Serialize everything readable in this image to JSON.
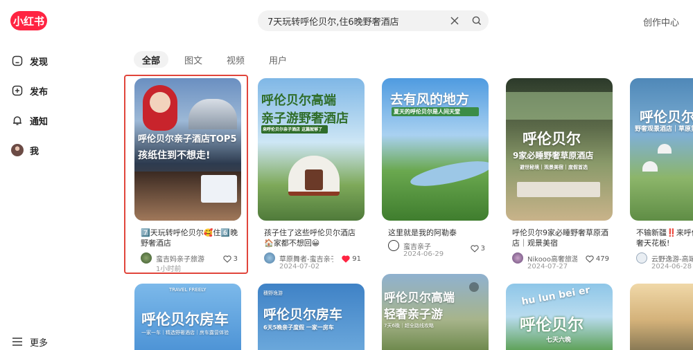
{
  "header": {
    "logo": "小红书",
    "search_value": "7天玩转呼伦贝尔,住6晚野奢酒店",
    "creator_center": "创作中心"
  },
  "sidebar": {
    "items": [
      {
        "label": "发现",
        "icon": "home-icon"
      },
      {
        "label": "发布",
        "icon": "add-square-icon"
      },
      {
        "label": "通知",
        "icon": "bell-icon"
      },
      {
        "label": "我",
        "icon": "avatar"
      }
    ],
    "more": "更多"
  },
  "tabs": [
    "全部",
    "图文",
    "视频",
    "用户"
  ],
  "active_tab": "全部",
  "cards": [
    {
      "title": "7️⃣天玩转呼伦贝尔🥰住6️⃣晚野奢酒店",
      "author": "蛮吉妈亲子旅游",
      "date": "1小时前",
      "likes": "3",
      "liked": false,
      "overlay": [
        "呼伦贝尔亲子酒店TOP5",
        "孩纸住到不想走!"
      ]
    },
    {
      "title": "孩子住了这些呼伦贝尔酒店🏠家都不想回😀",
      "author": "草原舞者-蛮吉亲子旅游",
      "date": "2024-07-02",
      "likes": "91",
      "liked": true,
      "overlay": [
        "呼伦贝尔高端",
        "亲子游野奢酒店",
        "来呼伦贝尔亲子酒店 这篇就够了"
      ]
    },
    {
      "title": "这里就是我的阿勒泰",
      "author": "蛮吉亲子",
      "date": "2024-06-29",
      "likes": "3",
      "liked": false,
      "overlay": [
        "去有风的地方",
        "夏天的呼伦贝尔是人间天堂"
      ]
    },
    {
      "title": "呼伦贝尔9家必睡野奢草原酒店｜观景美宿",
      "author": "Nikooo高奢旅游私人定制",
      "date": "2024-07-27",
      "likes": "479",
      "liked": false,
      "overlay": [
        "呼伦贝尔",
        "9家必睡野奢草原酒店",
        "避世秘境｜观景美宿｜度假首选"
      ]
    },
    {
      "title": "不输新疆‼️来呼伦贝尔草原野奢天花板!",
      "author": "云野逸游-高端定制",
      "date": "2024-06-28",
      "likes": "",
      "liked": false,
      "overlay": [
        "呼伦贝尔",
        "野奢观景酒店｜草原第一"
      ]
    }
  ],
  "row2_overlays": [
    {
      "small": "TRAVEL  FREELY",
      "big": "呼伦贝尔房车",
      "sub": "一家一车｜精选野奢酒店｜房车露营体验"
    },
    {
      "small": "穗野逸游",
      "big": "呼伦贝尔房车",
      "sub": "6天5晚亲子度假 一家一房车"
    },
    {
      "big": "呼伦贝尔高端",
      "big2": "轻奢亲子游",
      "sub": "7天6晚｜超全路线攻略"
    },
    {
      "big": "呼伦贝尔",
      "arc": "hu lun bei er",
      "sub": "七天六晚"
    },
    {}
  ],
  "colors": {
    "brand": "#ff2442",
    "highlight_frame": "#e0443a",
    "liked_heart": "#ff2442"
  }
}
